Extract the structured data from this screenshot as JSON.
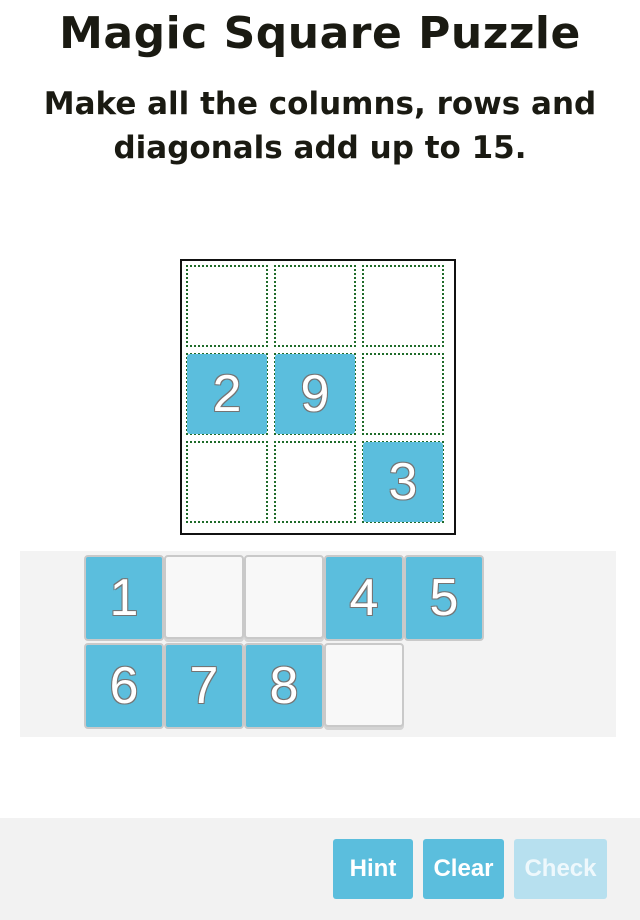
{
  "title": "Magic Square Puzzle",
  "instructions": {
    "line1": "Make all the columns, rows and",
    "line2": "diagonals add up to 15."
  },
  "board": {
    "cells": [
      [
        "",
        "",
        ""
      ],
      [
        "2",
        "9",
        ""
      ],
      [
        "",
        "",
        "3"
      ]
    ]
  },
  "tray": {
    "row1": [
      "1",
      "",
      "",
      "4",
      "5"
    ],
    "row2": [
      "6",
      "7",
      "8",
      ""
    ]
  },
  "buttons": {
    "hint": "Hint",
    "clear": "Clear",
    "check": "Check",
    "check_enabled": false
  },
  "colors": {
    "tile": "#5bbedd",
    "tile_disabled": "#b7e0ef",
    "cell_border": "#1f6b2a"
  }
}
